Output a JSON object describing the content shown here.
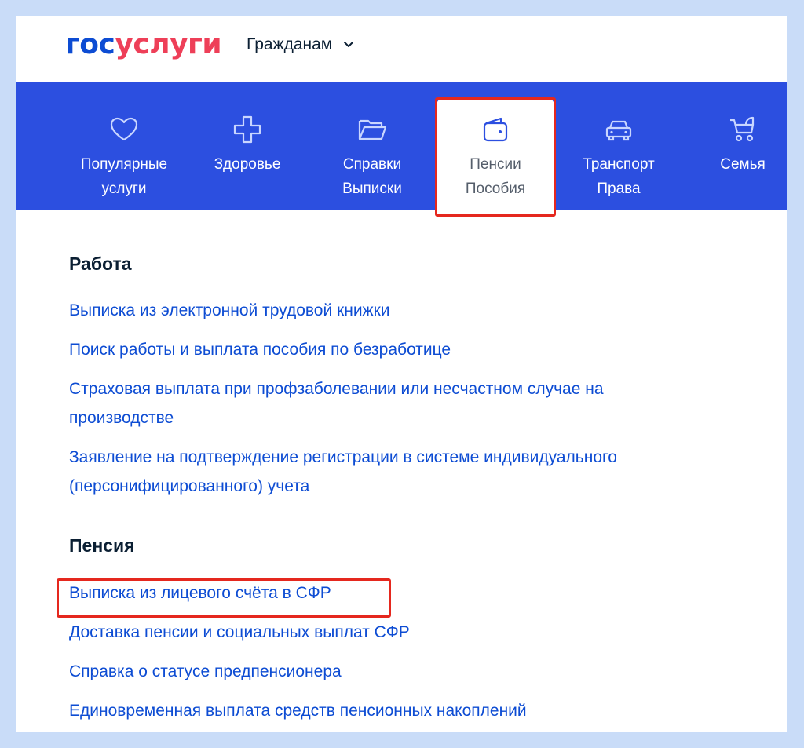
{
  "header": {
    "logo_part1": "гос",
    "logo_part2": "услуги",
    "audience_label": "Гражданам"
  },
  "colors": {
    "brand_blue": "#0d4cd3",
    "brand_red": "#ee3f58",
    "nav_bar": "#2c4fe0",
    "highlight": "#e5281e"
  },
  "categories": [
    {
      "icon": "heart-icon",
      "line1": "Популярные",
      "line2": "услуги"
    },
    {
      "icon": "medical-cross-icon",
      "line1": "Здоровье",
      "line2": ""
    },
    {
      "icon": "folder-icon",
      "line1": "Справки",
      "line2": "Выписки"
    },
    {
      "icon": "wallet-icon",
      "line1": "Пенсии",
      "line2": "Пособия",
      "active": true
    },
    {
      "icon": "car-icon",
      "line1": "Транспорт",
      "line2": "Права"
    },
    {
      "icon": "stroller-icon",
      "line1": "Семья",
      "line2": ""
    }
  ],
  "sections": [
    {
      "title": "Работа",
      "links": [
        "Выписка из электронной трудовой книжки",
        "Поиск работы и выплата пособия по безработице",
        "Страховая выплата при профзаболевании или несчастном случае на",
        "производстве",
        "Заявление на подтверждение регистрации в системе индивидуального",
        "(персонифицированного) учета"
      ]
    },
    {
      "title": "Пенсия",
      "links": [
        "Выписка из лицевого счёта в СФР",
        "Доставка пенсии и социальных выплат СФР",
        "Справка о статусе предпенсионера",
        "Единовременная выплата средств пенсионных накоплений"
      ]
    }
  ]
}
